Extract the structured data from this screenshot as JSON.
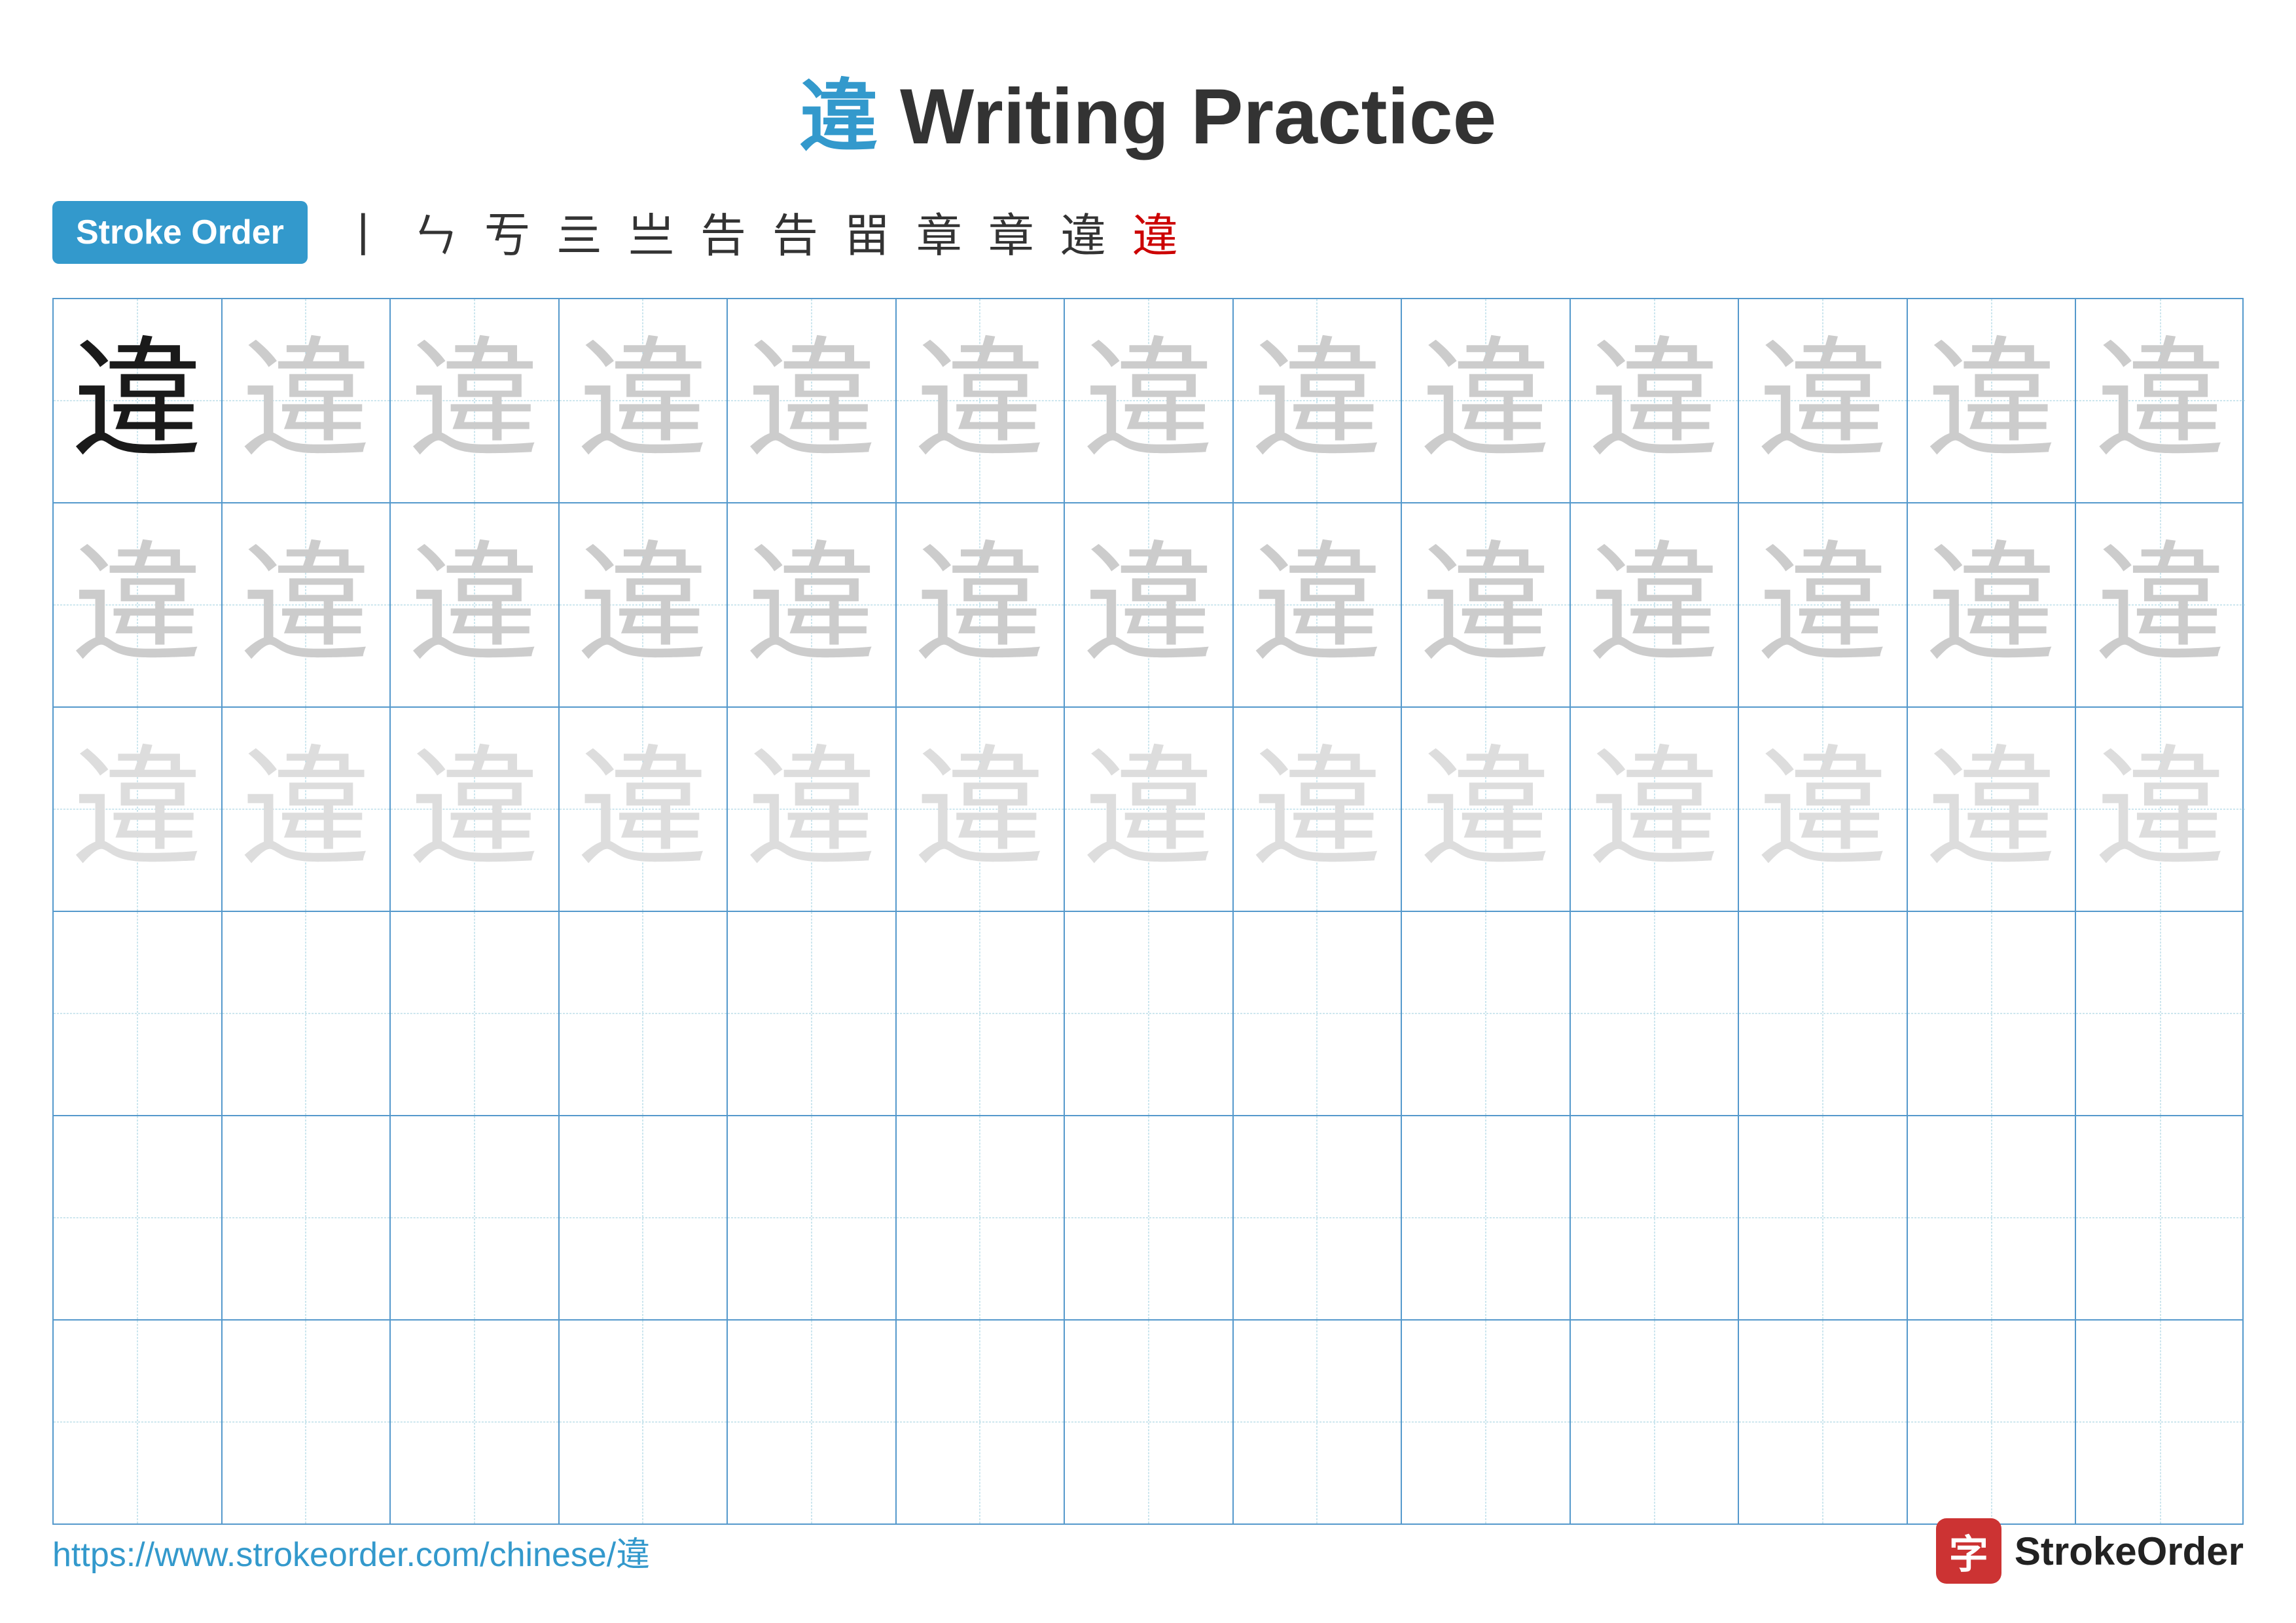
{
  "title": {
    "char": "違",
    "rest": " Writing Practice"
  },
  "stroke_order": {
    "badge_label": "Stroke Order",
    "strokes": [
      "丨",
      "ㄣ",
      "亐",
      "亖",
      "亗",
      "告",
      "告",
      "㽞",
      "章",
      "章",
      "違",
      "違"
    ]
  },
  "grid": {
    "rows": 6,
    "cols": 13,
    "char": "違",
    "row_configs": [
      {
        "type": "dark_then_light",
        "dark_count": 1
      },
      {
        "type": "all_light"
      },
      {
        "type": "all_lighter"
      },
      {
        "type": "empty"
      },
      {
        "type": "empty"
      },
      {
        "type": "empty"
      }
    ]
  },
  "footer": {
    "url": "https://www.strokeorder.com/chinese/違",
    "logo_text": "StrokeOrder",
    "logo_icon": "字"
  }
}
